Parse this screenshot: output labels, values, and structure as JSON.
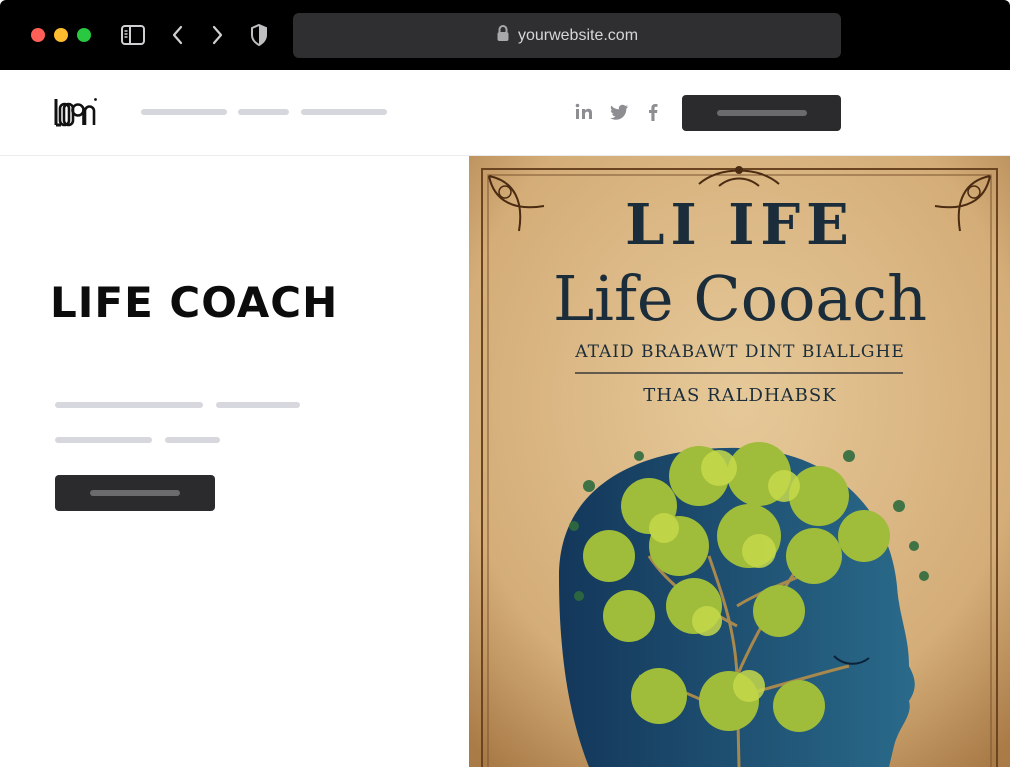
{
  "browser": {
    "url": "yourwebsite.com",
    "icons": [
      "sidebar-toggle-icon",
      "back-chevron-icon",
      "forward-chevron-icon",
      "shield-icon",
      "lock-icon"
    ]
  },
  "nav": {
    "logo_text": "LOGO",
    "social_icons": [
      "linkedin-icon",
      "twitter-icon",
      "facebook-icon"
    ]
  },
  "hero": {
    "title": "LIFE COACH"
  },
  "cover": {
    "line1": "LI IFE",
    "line2": "Life Cooach",
    "line3": "ATAID BRABAWT DINT BIALLGHE",
    "line4": "THAS RALDHABSK"
  },
  "colors": {
    "chrome_bg": "#000000",
    "address_bar": "#2f2f31",
    "button_dark": "#2b2b2d",
    "placeholder": "#d6d6dd",
    "cover_text": "#1b2d3a",
    "parchment": "#d9b684"
  }
}
